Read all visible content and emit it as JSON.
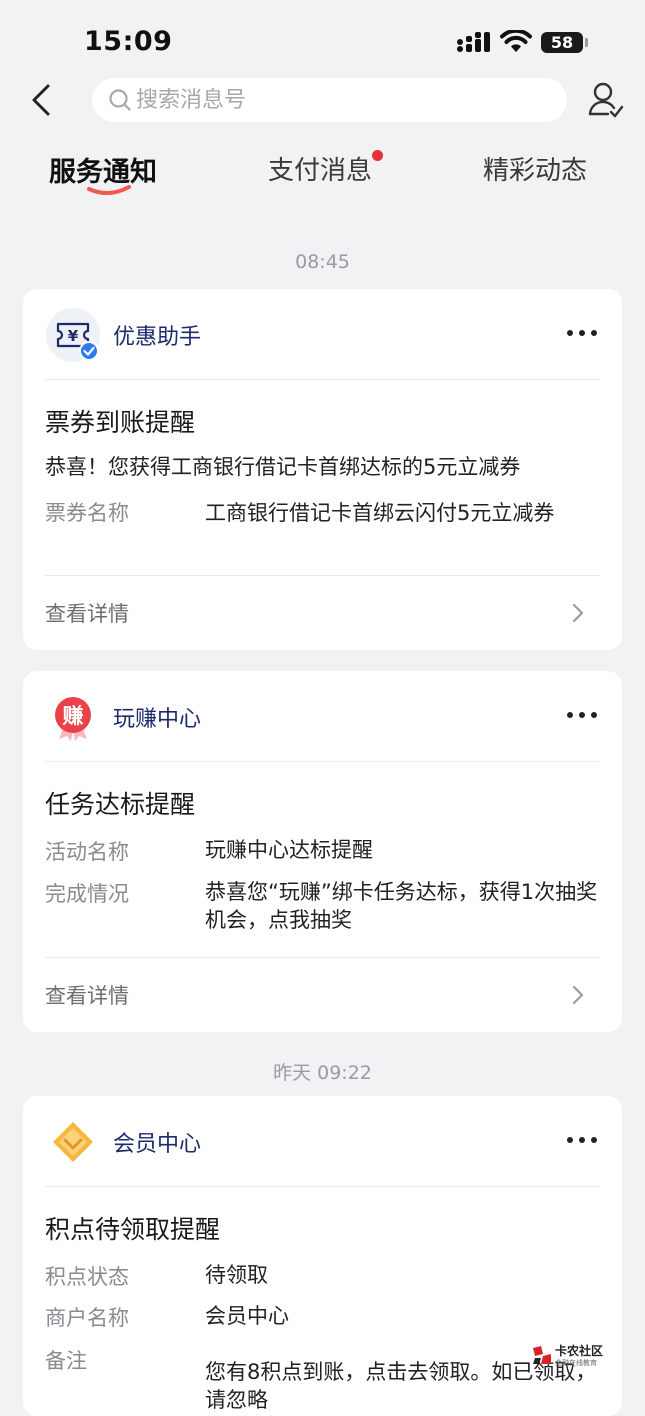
{
  "status_bar": {
    "time": "15:09",
    "battery": "58"
  },
  "header": {
    "search_placeholder": "搜索消息号"
  },
  "tabs": [
    {
      "label": "服务通知",
      "active": true
    },
    {
      "label": "支付消息",
      "active": false,
      "has_dot": true
    },
    {
      "label": "精彩动态",
      "active": false
    }
  ],
  "timestamps": [
    "08:45",
    "昨天 09:22"
  ],
  "cards": [
    {
      "source": "优惠助手",
      "title": "票券到账提醒",
      "text": "恭喜！您获得工商银行借记卡首绑达标的5元立减券",
      "fields": [
        {
          "label": "票券名称",
          "value": "工商银行借记卡首绑云闪付5元立减券"
        }
      ],
      "detail_label": "查看详情"
    },
    {
      "source": "玩赚中心",
      "logo_char": "赚",
      "title": "任务达标提醒",
      "fields": [
        {
          "label": "活动名称",
          "value": "玩赚中心达标提醒"
        },
        {
          "label": "完成情况",
          "value": "恭喜您“玩赚”绑卡任务达标，获得1次抽奖机会，点我抽奖"
        }
      ],
      "detail_label": "查看详情"
    },
    {
      "source": "会员中心",
      "title": "积点待领取提醒",
      "fields": [
        {
          "label": "积点状态",
          "value": "待领取"
        },
        {
          "label": "商户名称",
          "value": "会员中心"
        },
        {
          "label": "备注",
          "value": "您有8积点到账，点击去领取。如已领取，请忽略"
        }
      ]
    }
  ],
  "watermark": {
    "text": "卡农社区",
    "sub": "金融在线教育"
  },
  "colors": {
    "background": "#f2f2f4",
    "accent_red": "#e8303a",
    "source_blue": "#1d2a6b",
    "verified_blue": "#2f7bf5",
    "gold": "#f6b73c"
  }
}
